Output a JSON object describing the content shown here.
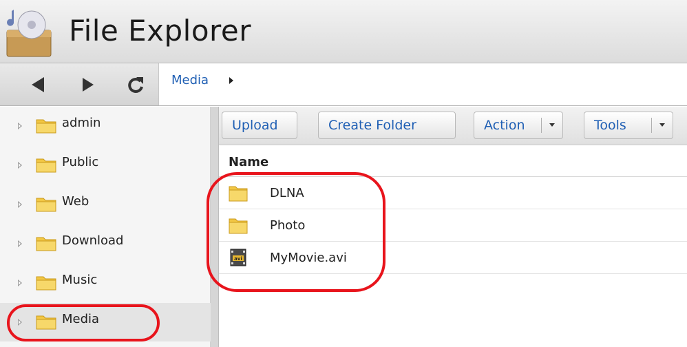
{
  "app": {
    "title": "File Explorer",
    "icon": "file-explorer-app-icon"
  },
  "nav": {
    "back_icon": "back-arrow-icon",
    "forward_icon": "forward-arrow-icon",
    "refresh_icon": "refresh-icon",
    "breadcrumb": [
      "Media"
    ]
  },
  "sidebar": {
    "items": [
      {
        "label": "admin",
        "selected": false
      },
      {
        "label": "Public",
        "selected": false
      },
      {
        "label": "Web",
        "selected": false
      },
      {
        "label": "Download",
        "selected": false
      },
      {
        "label": "Music",
        "selected": false
      },
      {
        "label": "Media",
        "selected": true
      }
    ]
  },
  "toolbar": {
    "upload": "Upload",
    "create_folder": "Create Folder",
    "action": "Action",
    "tools": "Tools"
  },
  "filelist": {
    "column_name": "Name",
    "rows": [
      {
        "name": "DLNA",
        "type": "folder"
      },
      {
        "name": "Photo",
        "type": "folder"
      },
      {
        "name": "MyMovie.avi",
        "type": "avi-file"
      }
    ]
  },
  "colors": {
    "link": "#1f5fb4",
    "highlight": "#e8141c",
    "folder": "#f2c744"
  }
}
